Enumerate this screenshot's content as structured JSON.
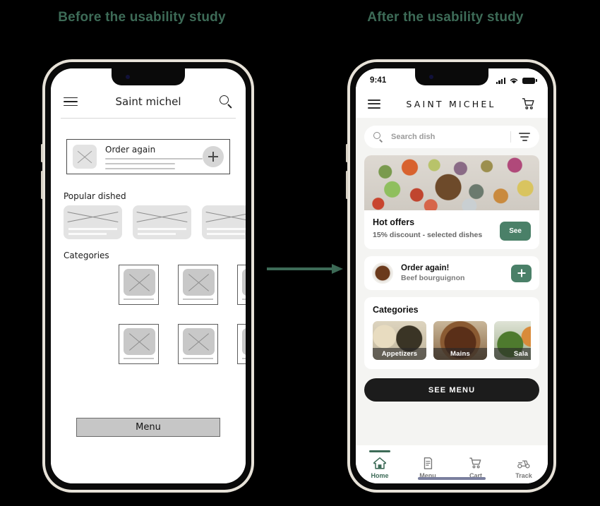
{
  "headings": {
    "before": "Before the usability study",
    "after": "After the usability study"
  },
  "arrow": {
    "name": "right-arrow",
    "color": "#3d6b57"
  },
  "colors": {
    "accent_green": "#3d6b57",
    "button_green": "#4a8068",
    "dark_button": "#1c1c1c",
    "screen_bg": "#f4f4f2",
    "phone_frame": "#e7e2d8"
  },
  "before_phone": {
    "header": {
      "menu_icon": "hamburger-icon",
      "title": "Saint michel",
      "search_icon": "search-icon"
    },
    "order_card": {
      "thumb": "image-placeholder-icon",
      "label": "Order again",
      "add_icon": "plus-icon"
    },
    "popular_label": "Popular dished",
    "popular_items": [
      {
        "name": "dish-placeholder-1"
      },
      {
        "name": "dish-placeholder-2"
      },
      {
        "name": "dish-placeholder-3"
      }
    ],
    "categories_label": "Categories",
    "category_tiles": [
      {
        "name": "category-placeholder-1"
      },
      {
        "name": "category-placeholder-2"
      },
      {
        "name": "category-placeholder-3"
      },
      {
        "name": "category-placeholder-4"
      },
      {
        "name": "category-placeholder-5"
      },
      {
        "name": "category-placeholder-6"
      }
    ],
    "menu_button": "Menu"
  },
  "after_phone": {
    "status": {
      "time": "9:41",
      "signal_icon": "cellular-signal-icon",
      "wifi_icon": "wifi-icon",
      "battery_icon": "battery-icon"
    },
    "header": {
      "menu_icon": "hamburger-icon",
      "brand": "SAINT MICHEL",
      "cart_icon": "shopping-cart-icon"
    },
    "search": {
      "placeholder": "Search dish",
      "value": "",
      "search_icon": "search-icon",
      "filter_icon": "filter-icon"
    },
    "hot_offers": {
      "image": "food-spread-photo",
      "title": "Hot offers",
      "subtitle": "15% discount - selected dishes",
      "cta": "See"
    },
    "order_again": {
      "thumb": "beef-bourguignon-photo",
      "title": "Order again!",
      "subtitle": "Beef bourguignon",
      "add_icon": "plus-icon"
    },
    "categories": {
      "title": "Categories",
      "items": [
        {
          "label": "Appetizers",
          "image": "appetizers-photo"
        },
        {
          "label": "Mains",
          "image": "mains-photo"
        },
        {
          "label": "Salads",
          "label_visible": "Sala",
          "image": "salads-photo"
        }
      ]
    },
    "see_menu_button": "SEE MENU",
    "tabs": [
      {
        "label": "Home",
        "icon": "home-icon",
        "active": true
      },
      {
        "label": "Menu",
        "icon": "menu-book-icon",
        "active": false
      },
      {
        "label": "Cart",
        "icon": "shopping-cart-icon",
        "active": false
      },
      {
        "label": "Track",
        "icon": "scooter-delivery-icon",
        "active": false
      }
    ]
  }
}
